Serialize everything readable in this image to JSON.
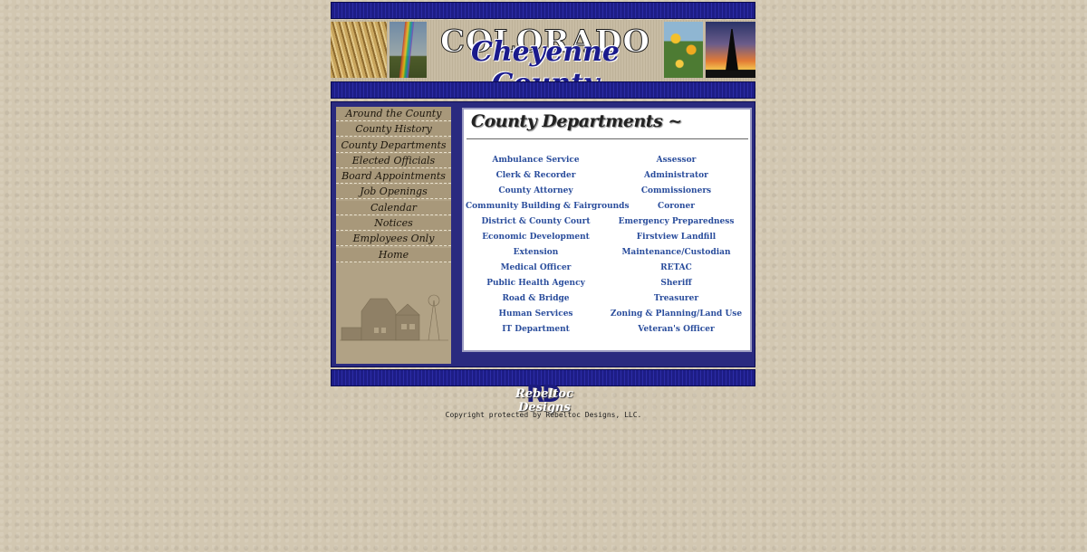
{
  "header": {
    "title_line1": "COLORADO",
    "title_line2": "Cheyenne County"
  },
  "sidebar": {
    "items": [
      {
        "label": "Around the County"
      },
      {
        "label": "County History"
      },
      {
        "label": "County Departments"
      },
      {
        "label": "Elected Officials"
      },
      {
        "label": "Board Appointments"
      },
      {
        "label": "Job Openings"
      },
      {
        "label": "Calendar"
      },
      {
        "label": "Notices"
      },
      {
        "label": "Employees Only"
      },
      {
        "label": "Home"
      }
    ]
  },
  "main": {
    "title": "County Departments ~",
    "departments_left": [
      "Ambulance Service",
      "Clerk & Recorder",
      "County Attorney",
      "Community Building & Fairgrounds",
      "District & County Court",
      "Economic Development",
      "Extension",
      "Medical Officer",
      "Public Health Agency",
      "Road & Bridge",
      "Human Services",
      "IT Department"
    ],
    "departments_right": [
      "Assessor",
      "Administrator",
      "Commissioners",
      "Coroner",
      "Emergency Preparedness",
      "Firstview Landfill",
      "Maintenance/Custodian",
      "RETAC",
      "Sheriff",
      "Treasurer",
      "Zoning & Planning/Land Use",
      "Veteran's Officer"
    ]
  },
  "footer": {
    "logo_mark": "RD",
    "logo_text": "Rebeltoc Designs",
    "copyright": "Copyright protected by Rebeltoc Designs, LLC."
  },
  "colors": {
    "page_bg": "#d2c7b1",
    "bar_blue": "#1d1d86",
    "link_blue": "#2a4d9c"
  }
}
